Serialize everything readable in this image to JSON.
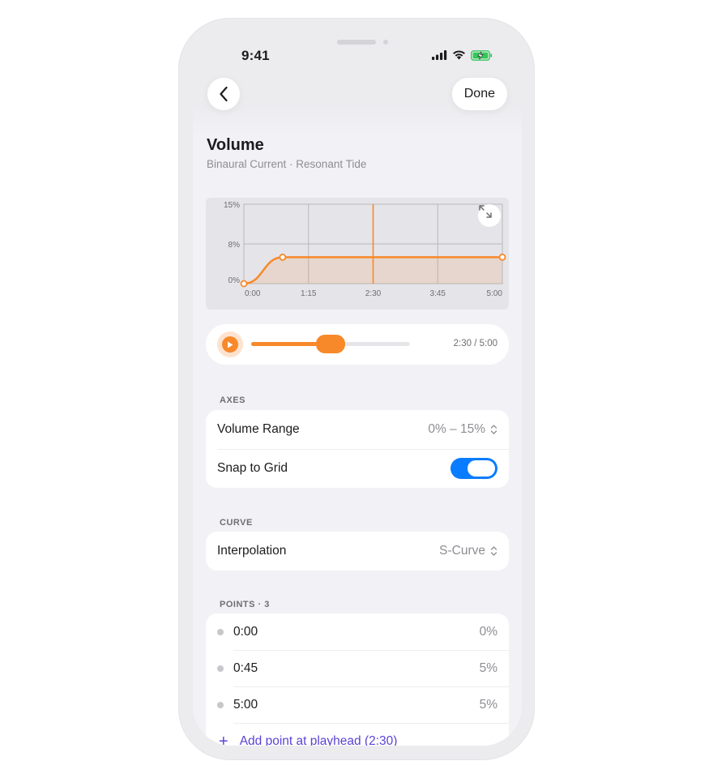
{
  "status_bar": {
    "time": "9:41"
  },
  "nav": {
    "done_label": "Done"
  },
  "header": {
    "title": "Volume",
    "subtitle": "Binaural Current · Resonant Tide"
  },
  "chart_data": {
    "type": "area",
    "x_tick_labels": [
      "0:00",
      "1:15",
      "2:30",
      "3:45",
      "5:00"
    ],
    "y_tick_labels": [
      "0%",
      "8%",
      "15%"
    ],
    "x_unit": "minutes:seconds",
    "xlim_seconds": [
      0,
      300
    ],
    "ylim": [
      0,
      15
    ],
    "grid": true,
    "playhead_seconds": 150,
    "points": [
      {
        "x_seconds": 0,
        "y": 0
      },
      {
        "x_seconds": 45,
        "y": 5
      },
      {
        "x_seconds": 300,
        "y": 5
      }
    ],
    "curve": "s-curve",
    "color": "#f7892a"
  },
  "player": {
    "time_label": "2:30 / 5:00",
    "progress": 0.5,
    "accent": "#f7892a"
  },
  "axes_section": {
    "label": "AXES",
    "volume_range_label": "Volume Range",
    "volume_range_value": "0% – 15%",
    "snap_label": "Snap to Grid",
    "snap_on": true
  },
  "curve_section": {
    "label": "CURVE",
    "interpolation_label": "Interpolation",
    "interpolation_value": "S-Curve"
  },
  "points_section": {
    "label": "POINTS · 3",
    "items": [
      {
        "time": "0:00",
        "value": "0%"
      },
      {
        "time": "0:45",
        "value": "5%"
      },
      {
        "time": "5:00",
        "value": "5%"
      }
    ],
    "add_label": "Add point at playhead (2:30)"
  },
  "colors": {
    "accent": "#f7892a",
    "toggle_on": "#0a7cff",
    "link": "#5b43d6"
  }
}
